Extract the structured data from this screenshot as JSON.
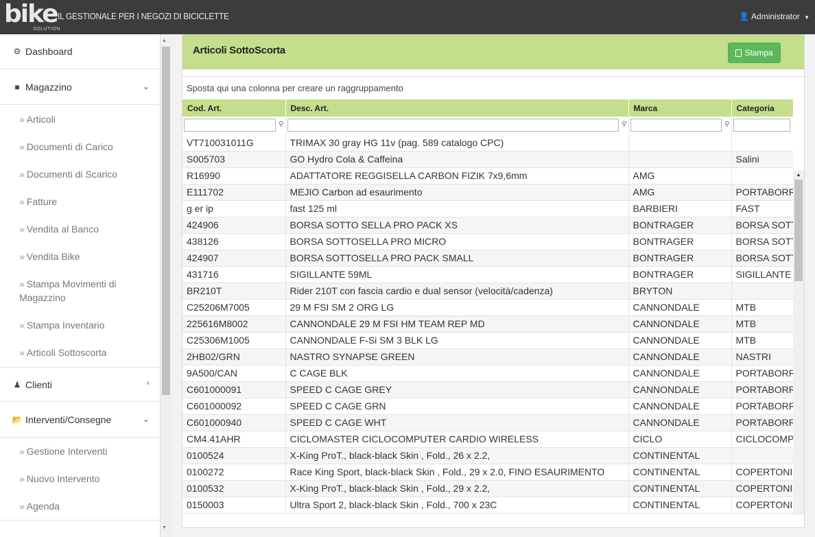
{
  "header": {
    "logo_text": "bike",
    "logo_sub": "SOLUTION",
    "tagline": "IL GESTIONALE PER I NEGOZI DI BICICLETTE",
    "user_label": "Administrator"
  },
  "sidebar": {
    "items": [
      {
        "label": "Dashboard",
        "icon": "dashboard-icon"
      },
      {
        "label": "Magazzino",
        "icon": "box-icon"
      },
      {
        "label": "Clienti",
        "icon": "person-icon"
      },
      {
        "label": "Interventi/Consegne",
        "icon": "folder-open-icon"
      }
    ],
    "magazzino_sub": [
      "Articoli",
      "Documenti di Carico",
      "Documenti di Scarico",
      "Fatture",
      "Vendita al Banco",
      "Vendita Bike",
      "Stampa Movimenti di Magazzino",
      "Stampa Inventario",
      "Articoli Sottoscorta"
    ],
    "interventi_sub": [
      "Gestione Interventi",
      "Nuovo Intervento",
      "Agenda"
    ]
  },
  "panel": {
    "title": "Articoli SottoScorta",
    "print_label": "Stampa"
  },
  "grid": {
    "group_hint": "Sposta qui una colonna per creare un raggruppamento",
    "columns": [
      "Cod. Art.",
      "Desc. Art.",
      "Marca",
      "Categoria"
    ],
    "rows": [
      [
        "VT710031011G",
        "TRIMAX 30 gray HG 11v (pag. 589 catalogo CPC)",
        "",
        ""
      ],
      [
        "S005703",
        "GO Hydro Cola & Caffeina",
        "",
        "Salini"
      ],
      [
        "R16990",
        "ADATTATORE REGGISELLA CARBON FIZIK 7x9,6mm",
        "AMG",
        ""
      ],
      [
        "E111702",
        "MEJIO Carbon ad esaurimento",
        "AMG",
        "PORTABORRACCE"
      ],
      [
        "g er ip",
        "fast 125 ml",
        "BARBIERI",
        "FAST"
      ],
      [
        "424906",
        "BORSA SOTTO SELLA PRO PACK XS",
        "BONTRAGER",
        "BORSA SOTTOSELLA"
      ],
      [
        "438126",
        "BORSA SOTTOSELLA PRO MICRO",
        "BONTRAGER",
        "BORSA SOTTOSELLA"
      ],
      [
        "424907",
        "BORSA SOTTOSELLA PRO PACK SMALL",
        "BONTRAGER",
        "BORSA SOTTOSELLA"
      ],
      [
        "431716",
        "SIGILLANTE 59ML",
        "BONTRAGER",
        "SIGILLANTE"
      ],
      [
        "BR210T",
        "Rider 210T con fascia cardio e dual sensor (velocità/cadenza)",
        "BRYTON",
        ""
      ],
      [
        "C25206M7005",
        "29 M FSI SM 2 ORG LG",
        "CANNONDALE",
        "MTB"
      ],
      [
        "225616M8002",
        "CANNONDALE 29 M FSI HM TEAM REP MD",
        "CANNONDALE",
        "MTB"
      ],
      [
        "C25306M1005",
        "CANNONDALE F-Si SM 3 BLK LG",
        "CANNONDALE",
        "MTB"
      ],
      [
        "2HB02/GRN",
        "NASTRO SYNAPSE GREEN",
        "CANNONDALE",
        "NASTRI"
      ],
      [
        "9A500/CAN",
        "C CAGE BLK",
        "CANNONDALE",
        "PORTABORRACCE"
      ],
      [
        "C601000091",
        "SPEED C CAGE GREY",
        "CANNONDALE",
        "PORTABORRACCE"
      ],
      [
        "C601000092",
        "SPEED C CAGE GRN",
        "CANNONDALE",
        "PORTABORRACCE"
      ],
      [
        "C601000940",
        "SPEED C CAGE WHT",
        "CANNONDALE",
        "PORTABORRACCE"
      ],
      [
        "CM4.41AHR",
        "CICLOMASTER CICLOCOMPUTER CARDIO WIRELESS",
        "CICLO",
        "CICLOCOMPUTER"
      ],
      [
        "0100524",
        "X-King ProT., black-black Skin , Fold., 26 x 2.2,",
        "CONTINENTAL",
        ""
      ],
      [
        "0100272",
        "Race King Sport, black-black Skin , Fold., 29 x 2.0, FINO ESAURIMENTO",
        "CONTINENTAL",
        "COPERTONI"
      ],
      [
        "0100532",
        "X-King ProT., black-black Skin , Fold., 29 x 2.2,",
        "CONTINENTAL",
        "COPERTONI"
      ],
      [
        "0150003",
        "Ultra Sport 2, black-black Skin , Fold., 700 x 23C",
        "CONTINENTAL",
        "COPERTONI"
      ]
    ]
  },
  "colors": {
    "header_bg": "#3c3c3c",
    "panel_accent": "#c5de8b",
    "button_green": "#5cb85c",
    "link_blue": "#3a7bbf"
  }
}
